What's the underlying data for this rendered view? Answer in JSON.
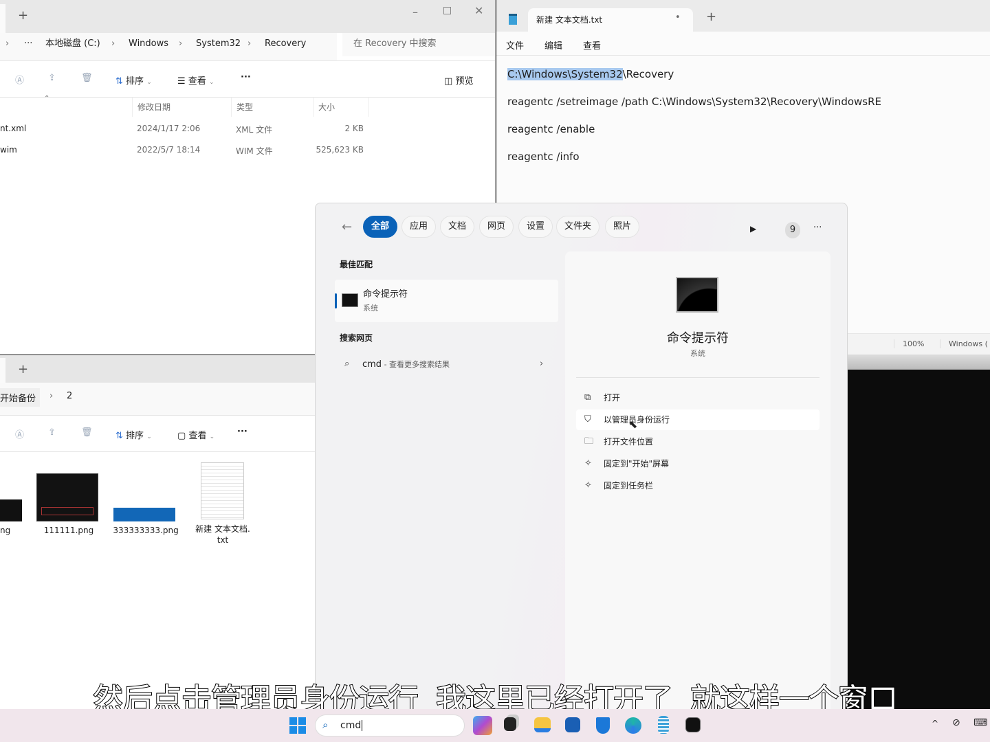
{
  "explorer_top": {
    "breadcrumb": [
      "本地磁盘 (C:)",
      "Windows",
      "System32",
      "Recovery"
    ],
    "search_placeholder": "在 Recovery 中搜索",
    "toolbar": {
      "sort": "排序",
      "view": "查看",
      "more": "···",
      "preview": "预览"
    },
    "columns": [
      "修改日期",
      "类型",
      "大小"
    ],
    "rows": [
      {
        "name": "nt.xml",
        "date": "2024/1/17 2:06",
        "type": "XML 文件",
        "size": "2 KB"
      },
      {
        "name": "wim",
        "date": "2022/5/7 18:14",
        "type": "WIM 文件",
        "size": "525,623 KB"
      }
    ]
  },
  "notepad": {
    "tab_title": "新建 文本文档.txt",
    "menu": [
      "文件",
      "编辑",
      "查看"
    ],
    "lines": [
      {
        "selected": "C:\\Windows\\System32",
        "rest": "\\Recovery"
      },
      {
        "selected": "",
        "rest": "reagentc /setreimage /path C:\\Windows\\System32\\Recovery\\WindowsRE"
      },
      {
        "selected": "",
        "rest": "reagentc /enable"
      },
      {
        "selected": "",
        "rest": "reagentc /info"
      }
    ],
    "status": {
      "zoom": "100%",
      "encoding": "Windows ("
    }
  },
  "explorer_bottom": {
    "breadcrumb": [
      "开始备份",
      "2"
    ],
    "toolbar": {
      "sort": "排序",
      "view": "查看",
      "more": "···"
    },
    "files": [
      {
        "name": "ng"
      },
      {
        "name": "111111.png"
      },
      {
        "name": "333333333.png"
      },
      {
        "name": "新建 文本文档.\ntxt"
      }
    ]
  },
  "search": {
    "filters": [
      "全部",
      "应用",
      "文档",
      "网页",
      "设置",
      "文件夹",
      "照片"
    ],
    "badge": "9",
    "more": "···",
    "best_match_heading": "最佳匹配",
    "best_match": {
      "name": "命令提示符",
      "sub": "系统"
    },
    "web_heading": "搜索网页",
    "web_query": "cmd",
    "web_suffix": " - 查看更多搜索结果",
    "detail": {
      "name": "命令提示符",
      "sub": "系统"
    },
    "actions": [
      {
        "label": "打开",
        "icon": "open-external-icon"
      },
      {
        "label": "以管理员身份运行",
        "icon": "shield-admin-icon"
      },
      {
        "label": "打开文件位置",
        "icon": "folder-icon"
      },
      {
        "label": "固定到\"开始\"屏幕",
        "icon": "pin-icon"
      },
      {
        "label": "固定到任务栏",
        "icon": "pin-icon"
      }
    ]
  },
  "subtitle": "然后点击管理员身份运行  我这里已经打开了  就这样一个窗口",
  "taskbar": {
    "search_value": "cmd"
  },
  "colors": {
    "accent": "#0a62b8",
    "selection": "#a8c9ef"
  }
}
